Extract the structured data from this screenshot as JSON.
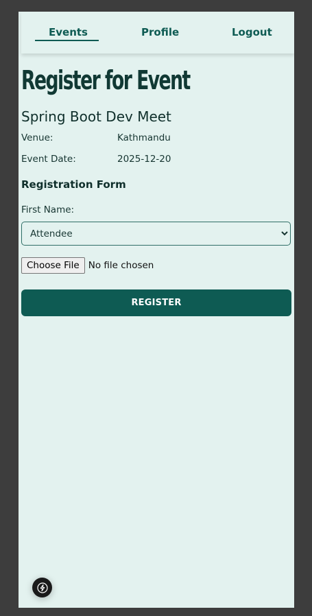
{
  "nav": {
    "items": [
      {
        "label": "Events",
        "active": true
      },
      {
        "label": "Profile",
        "active": false
      },
      {
        "label": "Logout",
        "active": false
      }
    ]
  },
  "page": {
    "title": "Register for Event"
  },
  "event": {
    "name": "Spring Boot Dev Meet",
    "venue_label": "Venue:",
    "venue_value": "Kathmandu",
    "date_label": "Event Date:",
    "date_value": "2025-12-20"
  },
  "form": {
    "heading": "Registration Form",
    "first_name_label": "First Name:",
    "role_select": {
      "selected": "Attendee",
      "options": [
        "Attendee"
      ]
    },
    "file_button_label": "Choose File",
    "file_status": "No file chosen",
    "submit_label": "REGISTER"
  },
  "icons": {
    "dev_indicator": "lightning-bolt-icon"
  },
  "colors": {
    "accent": "#0e5b53",
    "page_background": "#e3f2ef",
    "outer_background": "#3d3d3d",
    "title_text": "#113934"
  }
}
